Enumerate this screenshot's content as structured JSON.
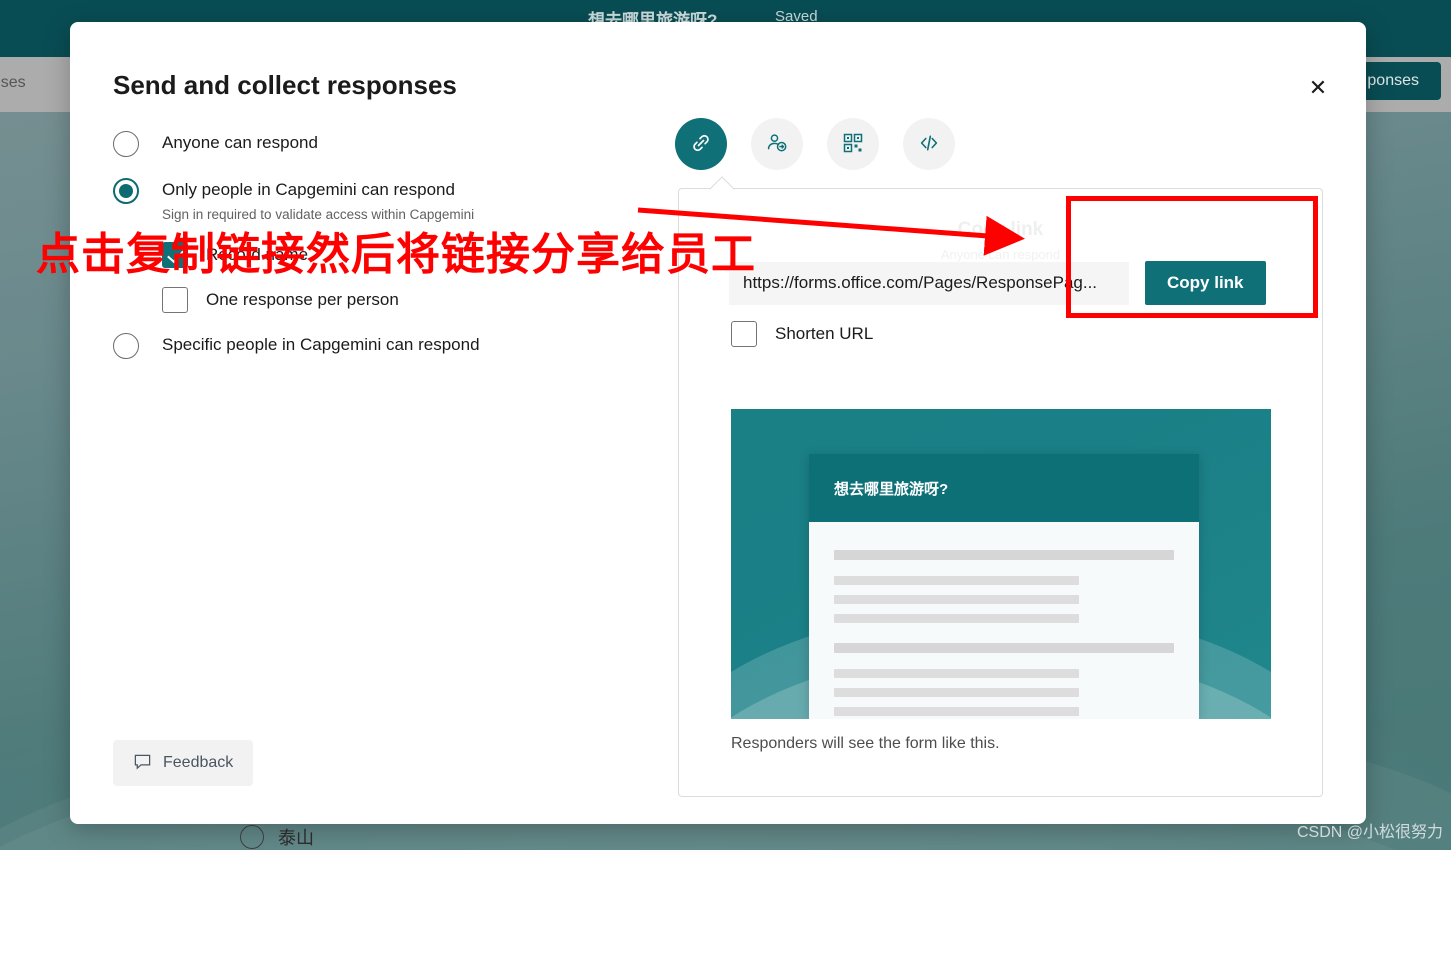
{
  "background": {
    "form_title": "想去哪里旅游呀?",
    "save_status": "Saved",
    "left_tab_label": "sponses",
    "collect_button_label": "ponses",
    "question_option_label": "泰山"
  },
  "modal": {
    "title": "Send and collect responses",
    "close_icon": "close-icon",
    "close_label": "✕"
  },
  "audience": {
    "options": [
      {
        "label": "Anyone can respond",
        "selected": false
      },
      {
        "label": "Only people in Capgemini can respond",
        "selected": true,
        "sub_text": "Sign in required to validate access within Capgemini"
      },
      {
        "label": "Specific people in Capgemini can respond",
        "selected": false
      }
    ],
    "sub_checkboxes": [
      {
        "label": "Record name",
        "checked": true
      },
      {
        "label": "One response per person",
        "checked": false
      }
    ]
  },
  "share_tabs": [
    {
      "icon": "link-icon",
      "label": "Link",
      "active": true
    },
    {
      "icon": "person-share-icon",
      "label": "Invite",
      "active": false
    },
    {
      "icon": "qr-code-icon",
      "label": "QR code",
      "active": false
    },
    {
      "icon": "embed-code-icon",
      "label": "Embed",
      "active": false
    }
  ],
  "share_panel": {
    "heading": "Copy link",
    "subheading": "Anyone can respond",
    "url_value": "https://forms.office.com/Pages/ResponsePag...",
    "copy_button_label": "Copy link",
    "shorten_url": {
      "label": "Shorten URL",
      "checked": false
    },
    "preview_caption": "Responders will see the form like this.",
    "preview_card_title": "想去哪里旅游呀?"
  },
  "feedback": {
    "icon": "comment-icon",
    "label": "Feedback"
  },
  "annotations": {
    "callout_text": "点击复制链接然后将链接分享给员工",
    "highlight_color": "#fe0000"
  },
  "watermark": "CSDN @小松很努力",
  "colors": {
    "accent_teal": "#0f7077",
    "dark_teal": "#0a5158",
    "annotation_red": "#fe0000"
  }
}
